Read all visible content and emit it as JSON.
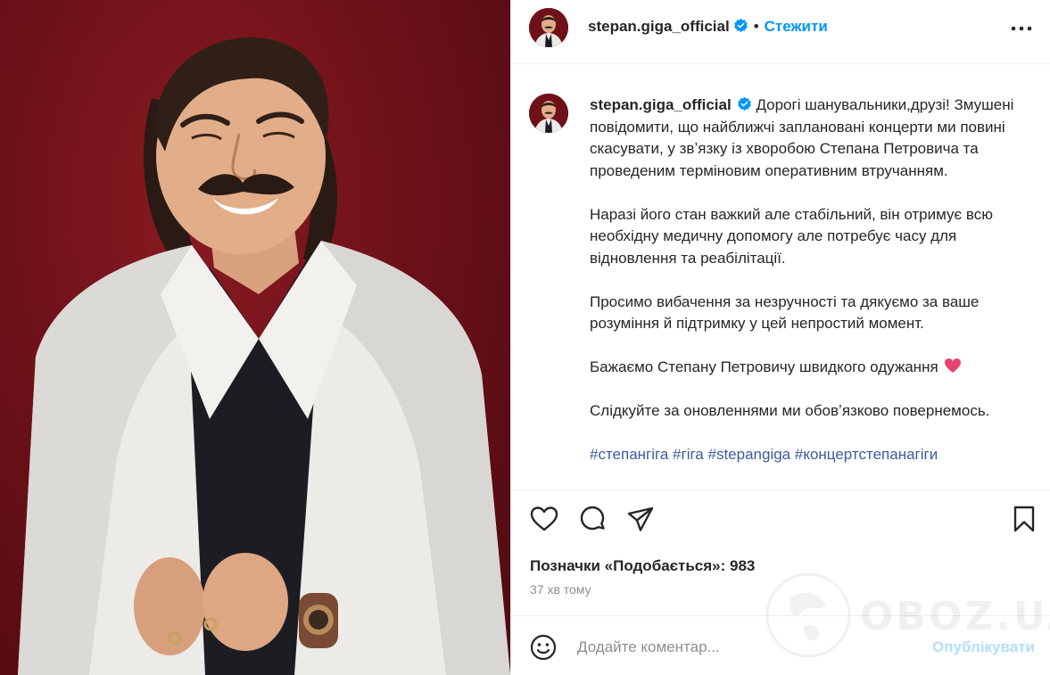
{
  "post": {
    "username": "stepan.giga_official",
    "follow_label": "Стежити",
    "separator": "•",
    "caption_intro": "Дорогі шанувальники,друзі! Змушені повідомити, що найближчі заплановані концерти ми повині скасувати, у звʼязку із хворобою Степана Петровича та проведеним терміновим оперативним втручанням.",
    "caption_p2": "Наразі його стан важкий але стабільний, він отримує всю необхідну медичну допомогу але потребує часу для відновлення та реабілітації.",
    "caption_p3": "Просимо вибачення за незручності та дякуємо за ваше розуміння й підтримку у цей непростий момент.",
    "caption_p4": "Бажаємо Степану Петровичу швидкого одужання",
    "caption_p5": "Слідкуйте за оновленнями ми обовʼязково повернемось.",
    "hashtags": [
      "#степангіга",
      "#гіга",
      "#stepangiga",
      "#концертстепанагіги"
    ],
    "likes_text": "Позначки «Подобається»: 983",
    "time_ago": "37 хв тому"
  },
  "comment": {
    "placeholder": "Додайте коментар...",
    "publish_label": "Опублікувати"
  },
  "watermark": {
    "text": "OBOZ.UA"
  },
  "icons": {
    "verified": "verified-badge-icon",
    "more": "more-options-icon",
    "like": "heart-icon",
    "comment": "comment-icon",
    "share": "share-icon",
    "save": "bookmark-icon",
    "emoji": "emoji-icon",
    "heart_emoji": "pink-heart-emoji"
  },
  "colors": {
    "accent": "#0095f6",
    "publish_disabled": "#b2dffc",
    "hashtag": "#3d5a9e",
    "background_photo": "#6e1119",
    "verified": "#0095f6",
    "heart_emoji": "#e8436e"
  }
}
